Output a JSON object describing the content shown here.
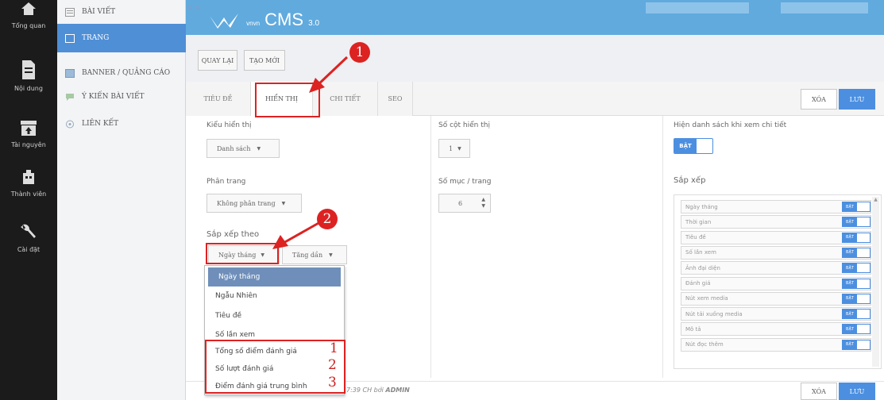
{
  "left_nav": [
    {
      "label": "Tổng quan",
      "icon": "home-icon"
    },
    {
      "label": "Nội dung",
      "icon": "document-icon"
    },
    {
      "label": "Tài nguyên",
      "icon": "box-icon"
    },
    {
      "label": "Thành viên",
      "icon": "users-icon"
    },
    {
      "label": "Cài đặt",
      "icon": "wrench-icon"
    }
  ],
  "sidebar": [
    {
      "label": "BÀI VIẾT",
      "icon": "article-icon"
    },
    {
      "label": "TRANG",
      "icon": "page-icon",
      "active": true
    },
    {
      "label": "BANNER / QUẢNG CÁO",
      "icon": "banner-icon"
    },
    {
      "label": "Ý KIẾN BÀI VIẾT",
      "icon": "comment-icon"
    },
    {
      "label": "LIÊN KẾT",
      "icon": "link-icon"
    }
  ],
  "header": {
    "collapse": "<<",
    "logo_small": "vnvn",
    "logo_text": "CMS",
    "logo_version": "3.0"
  },
  "toolbar": {
    "back": "QUAY LẠI",
    "new": "TẠO MỚI"
  },
  "tabs": [
    "TIÊU ĐỀ",
    "HIỂN THỊ",
    "CHI TIẾT",
    "SEO"
  ],
  "actions": {
    "delete": "XÓA",
    "save": "LƯU"
  },
  "form": {
    "display_type_label": "Kiểu hiển thị",
    "display_type_value": "Danh sách",
    "columns_label": "Số cột hiển thị",
    "columns_value": "1",
    "show_list_label": "Hiện danh sách khi xem chi tiết",
    "show_list_toggle": "BẬT",
    "paging_label": "Phân trang",
    "paging_value": "Không phân trang",
    "per_page_label": "Số mục / trang",
    "per_page_value": "6",
    "sort_panel_label": "Sắp xếp",
    "sort_by_label": "Sắp xếp theo",
    "sort_by_value": "Ngày tháng",
    "sort_order_value": "Tăng dần"
  },
  "sort_list": [
    {
      "label": "Ngày tháng",
      "toggle": "BẬT"
    },
    {
      "label": "Thời gian",
      "toggle": "BẬT"
    },
    {
      "label": "Tiêu đề",
      "toggle": "BẬT"
    },
    {
      "label": "Số lần xem",
      "toggle": "BẬT"
    },
    {
      "label": "Ảnh đại diện",
      "toggle": "BẬT"
    },
    {
      "label": "Đánh giá",
      "toggle": "BẬT"
    },
    {
      "label": "Nút xem media",
      "toggle": "BẬT"
    },
    {
      "label": "Nút tải xuống media",
      "toggle": "BẬT"
    },
    {
      "label": "Mô tả",
      "toggle": "BẬT"
    },
    {
      "label": "Nút đọc thêm",
      "toggle": "BẬT"
    }
  ],
  "dropdown": [
    "Ngày tháng",
    "Ngẫu Nhiên",
    "Tiêu đề",
    "Số lần xem",
    "Tổng số điểm đánh giá",
    "Số lượt đánh giá",
    "Điểm đánh giá trung bình"
  ],
  "annotations": {
    "marker1": "1",
    "marker2": "2",
    "nums": [
      "1",
      "2",
      "3"
    ],
    "accent": "#d22222"
  },
  "footer": {
    "timestamp": "7:39 CH bởi",
    "user": "ADMIN"
  }
}
